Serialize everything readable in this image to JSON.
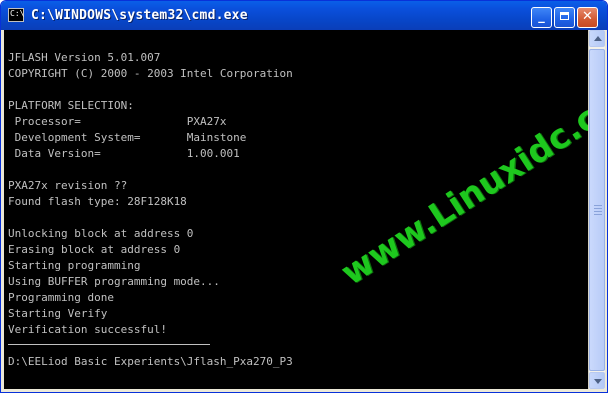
{
  "window": {
    "title": "C:\\WINDOWS\\system32\\cmd.exe",
    "icon_label": "C:\\"
  },
  "controls": {
    "minimize_icon": "minimize-icon",
    "maximize_icon": "maximize-icon",
    "close_icon": "close-icon",
    "minimize_glyph": "_",
    "close_glyph": "✕"
  },
  "console": {
    "lines": [
      "JFLASH Version 5.01.007",
      "COPYRIGHT (C) 2000 - 2003 Intel Corporation",
      "",
      "PLATFORM SELECTION:",
      " Processor=                PXA27x",
      " Development System=       Mainstone",
      " Data Version=             1.00.001",
      "",
      "PXA27x revision ??",
      "Found flash type: 28F128K18",
      "",
      "Unlocking block at address 0",
      "Erasing block at address 0",
      "Starting programming",
      "Using BUFFER programming mode...",
      "Programming done",
      "Starting Verify",
      "Verification successful!",
      "",
      "D:\\EELiod Basic Experients\\Jflash_Pxa270_P3"
    ],
    "text_color": "#c0c0c0",
    "background": "#000000"
  },
  "watermark": {
    "text": "www.Linuxidc.com",
    "color": "#1ec81e"
  }
}
